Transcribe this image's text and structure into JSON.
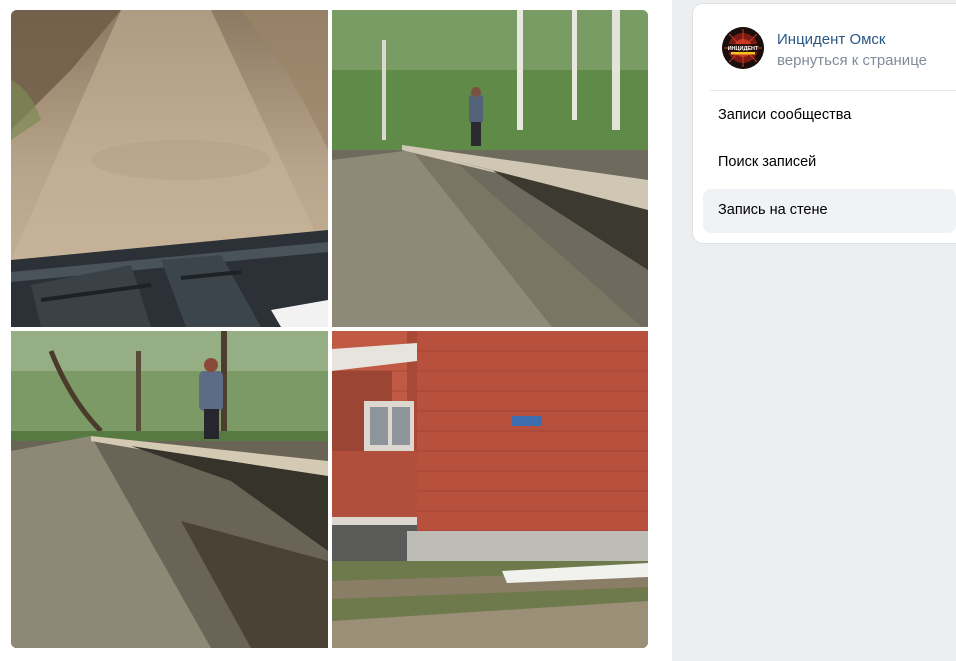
{
  "group": {
    "name": "Инцидент Омск",
    "back_link": "вернуться к странице",
    "avatar_text": "ИНЦИДЕНТ"
  },
  "menu": {
    "items": [
      {
        "label": "Записи сообщества",
        "active": false
      },
      {
        "label": "Поиск записей",
        "active": false
      },
      {
        "label": "Запись на стене",
        "active": true
      }
    ]
  },
  "photos": [
    {
      "subject": "dirt road seen from quad bike handlebars"
    },
    {
      "subject": "flooded muddy path with person walking on raised edge"
    },
    {
      "subject": "person balancing on raised edge beside muddy path in forest"
    },
    {
      "subject": "red brick building corner with street sign"
    }
  ],
  "colors": {
    "link": "#2a5885",
    "secondary": "#818c99",
    "page_bg": "#edeef0",
    "active_item": "#f0f2f5"
  }
}
